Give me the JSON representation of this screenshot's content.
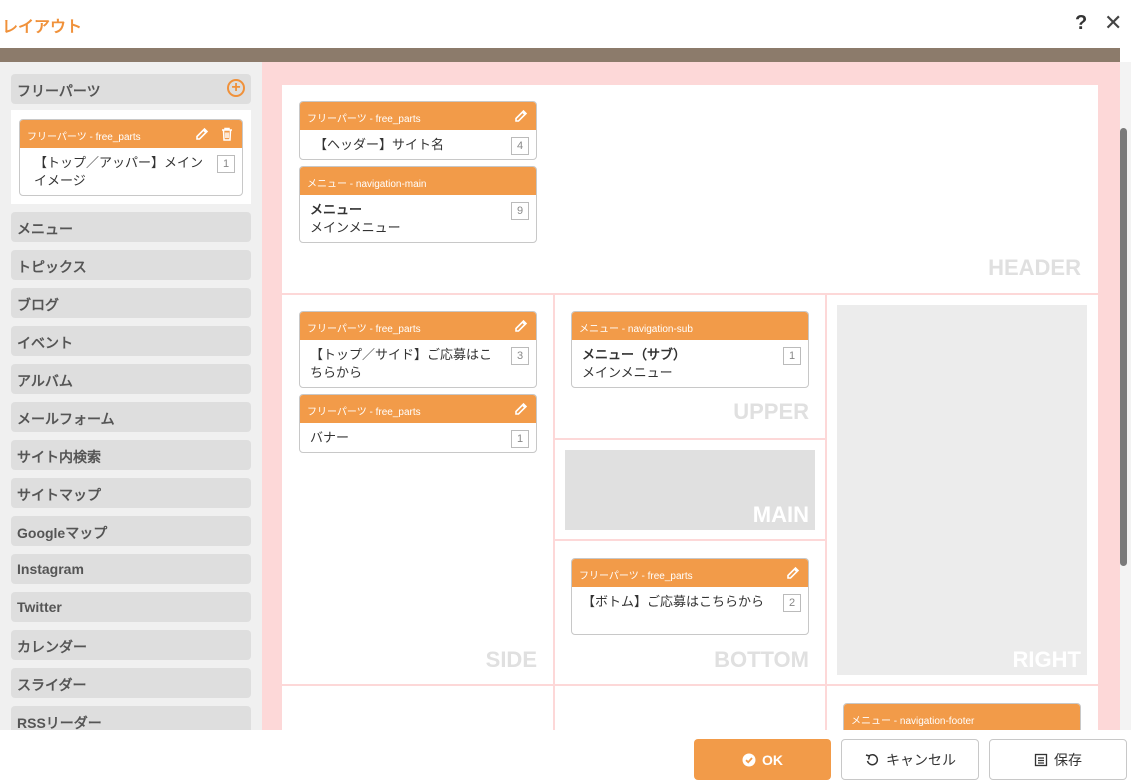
{
  "window": {
    "title": "レイアウト",
    "help_label": "?",
    "close_label": "✕"
  },
  "sidebar": {
    "free_parts_label": "フリーパーツ",
    "free_parts_card": {
      "header": "フリーパーツ - free_parts",
      "body": "【トップ／アッパー】メインイメージ",
      "count": "1"
    },
    "categories": [
      "メニュー",
      "トピックス",
      "ブログ",
      "イベント",
      "アルバム",
      "メールフォーム",
      "サイト内検索",
      "サイトマップ",
      "Googleマップ",
      "Instagram",
      "Twitter",
      "カレンダー",
      "スライダー",
      "RSSリーダー"
    ]
  },
  "zones": {
    "header": "HEADER",
    "side": "SIDE",
    "upper": "UPPER",
    "main": "MAIN",
    "bottom": "BOTTOM",
    "right": "RIGHT"
  },
  "cards": {
    "header1": {
      "header": "フリーパーツ - free_parts",
      "body": "【ヘッダー】サイト名",
      "count": "4"
    },
    "header2": {
      "header": "メニュー - navigation-main",
      "title": "メニュー",
      "body": "メインメニュー",
      "count": "9"
    },
    "side1": {
      "header": "フリーパーツ - free_parts",
      "body": "【トップ／サイド】ご応募はこちらから",
      "count": "3"
    },
    "side2": {
      "header": "フリーパーツ - free_parts",
      "body": "バナー",
      "count": "1"
    },
    "upper1": {
      "header": "メニュー - navigation-sub",
      "title": "メニュー（サブ）",
      "body": "メインメニュー",
      "count": "1"
    },
    "bottom1": {
      "header": "フリーパーツ - free_parts",
      "body": "【ボトム】ご応募はこちらから",
      "count": "2"
    },
    "footer1": {
      "header": "メニュー - navigation-footer"
    }
  },
  "buttons": {
    "ok": "OK",
    "cancel": "キャンセル",
    "save": "保存"
  },
  "colors": {
    "accent": "#f29b49",
    "canvas": "#fdd8d8"
  }
}
